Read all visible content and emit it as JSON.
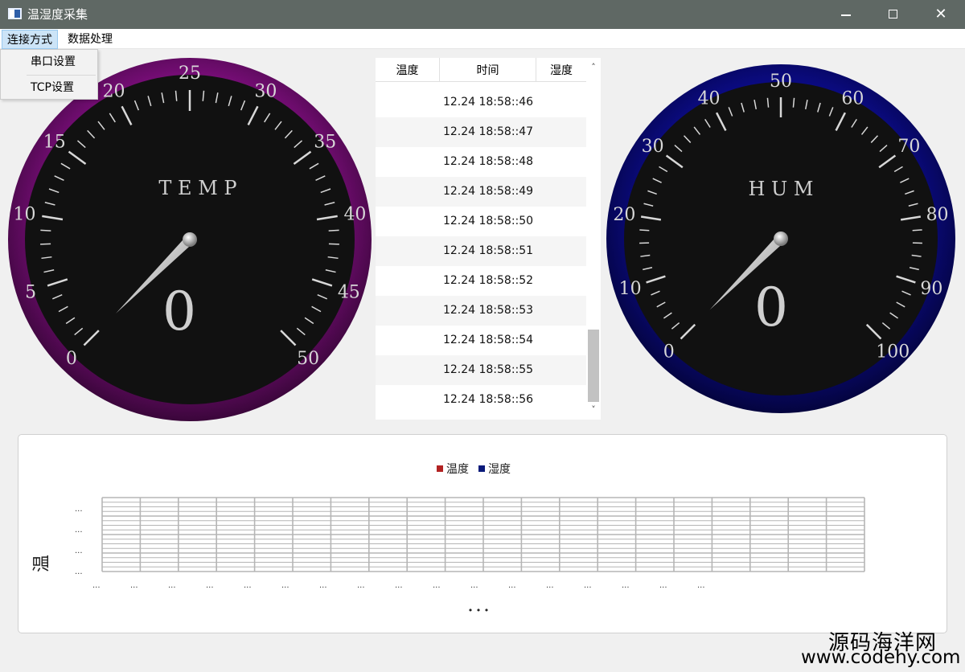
{
  "window": {
    "title": "温湿度采集",
    "minimize": "—",
    "close": "✕"
  },
  "menu": {
    "connection": "连接方式",
    "data": "数据处理",
    "dropdown": {
      "serial": "串口设置",
      "tcp": "TCP设置"
    }
  },
  "temp_gauge": {
    "label": "T E M P",
    "value_text": "0",
    "value": 0,
    "min": 0,
    "max": 50,
    "ticks": [
      "0",
      "5",
      "10",
      "15",
      "20",
      "25",
      "30",
      "35",
      "40",
      "45",
      "50"
    ],
    "ring_color": "#7a0f7a"
  },
  "hum_gauge": {
    "label": "H U M",
    "value_text": "0",
    "value": 0,
    "min": 0,
    "max": 100,
    "ticks": [
      "0",
      "10",
      "20",
      "30",
      "40",
      "50",
      "60",
      "70",
      "80",
      "90",
      "100"
    ],
    "ring_color": "#0a0a8a"
  },
  "table": {
    "columns": [
      "温度",
      "时间",
      "湿度"
    ],
    "rows": [
      {
        "temp": "",
        "time": "12.24 18:58::46",
        "hum": ""
      },
      {
        "temp": "",
        "time": "12.24 18:58::47",
        "hum": ""
      },
      {
        "temp": "",
        "time": "12.24 18:58::48",
        "hum": ""
      },
      {
        "temp": "",
        "time": "12.24 18:58::49",
        "hum": ""
      },
      {
        "temp": "",
        "time": "12.24 18:58::50",
        "hum": ""
      },
      {
        "temp": "",
        "time": "12.24 18:58::51",
        "hum": ""
      },
      {
        "temp": "",
        "time": "12.24 18:58::52",
        "hum": ""
      },
      {
        "temp": "",
        "time": "12.24 18:58::53",
        "hum": ""
      },
      {
        "temp": "",
        "time": "12.24 18:58::54",
        "hum": ""
      },
      {
        "temp": "",
        "time": "12.24 18:58::55",
        "hum": ""
      },
      {
        "temp": "",
        "time": "12.24 18:58::56",
        "hum": ""
      }
    ],
    "scroll_up": "˄",
    "scroll_down": "˅"
  },
  "chart": {
    "legend": [
      {
        "name": "温度",
        "color": "#b22222"
      },
      {
        "name": "湿度",
        "color": "#0a1a7a"
      }
    ],
    "y_axis_label": "温",
    "truncated_label": "...",
    "x_title": "• • •"
  },
  "chart_data": {
    "type": "line",
    "series": [
      {
        "name": "温度",
        "values": []
      },
      {
        "name": "湿度",
        "values": []
      }
    ],
    "xlabel": "• • •",
    "ylabel": "温",
    "grid": true,
    "legend": "top-center"
  },
  "watermark": {
    "cn": "源码海洋网",
    "url": "www.codehy.com"
  }
}
